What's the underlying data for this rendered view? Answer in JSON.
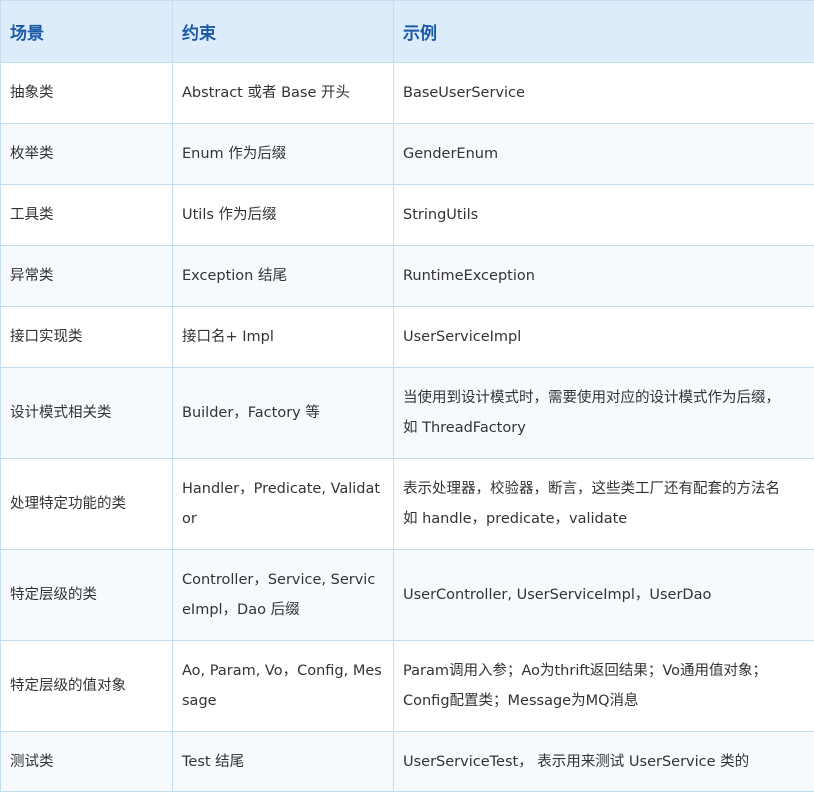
{
  "table": {
    "headers": {
      "scene": "场景",
      "constraint": "约束",
      "example": "示例"
    },
    "rows": [
      {
        "scene": "抽象类",
        "constraint": "Abstract 或者 Base 开头",
        "example": "BaseUserService"
      },
      {
        "scene": "枚举类",
        "constraint": "Enum 作为后缀",
        "example": "GenderEnum"
      },
      {
        "scene": "工具类",
        "constraint": "Utils 作为后缀",
        "example": "StringUtils"
      },
      {
        "scene": "异常类",
        "constraint": "Exception 结尾",
        "example": "RuntimeException"
      },
      {
        "scene": "接口实现类",
        "constraint": "接口名+ Impl",
        "example": "UserServiceImpl"
      },
      {
        "scene": "设计模式相关类",
        "constraint": "Builder，Factory 等",
        "example_lines": [
          "当使用到设计模式时，需要使用对应的设计模式作为后缀，",
          "如 ThreadFactory"
        ]
      },
      {
        "scene": "处理特定功能的类",
        "constraint_lines": [
          "Handler，Predicate,",
          "Validator"
        ],
        "example_lines": [
          "表示处理器，校验器，断言，这些类工厂还有配套的方法名",
          "如 handle，predicate，validate"
        ]
      },
      {
        "scene": "特定层级的类",
        "constraint_lines": [
          "Controller，Service,",
          "ServiceImpl，Dao 后缀"
        ],
        "example": "UserController, UserServiceImpl，UserDao"
      },
      {
        "scene": "特定层级的值对象",
        "constraint_lines": [
          "Ao, Param, Vo，Config,",
          "Message"
        ],
        "example_lines": [
          "Param调用入参；Ao为thrift返回结果；Vo通用值对象；",
          "Config配置类；Message为MQ消息"
        ]
      },
      {
        "scene": "测试类",
        "constraint": "Test 结尾",
        "example": "UserServiceTest， 表示用来测试 UserService 类的"
      }
    ]
  }
}
